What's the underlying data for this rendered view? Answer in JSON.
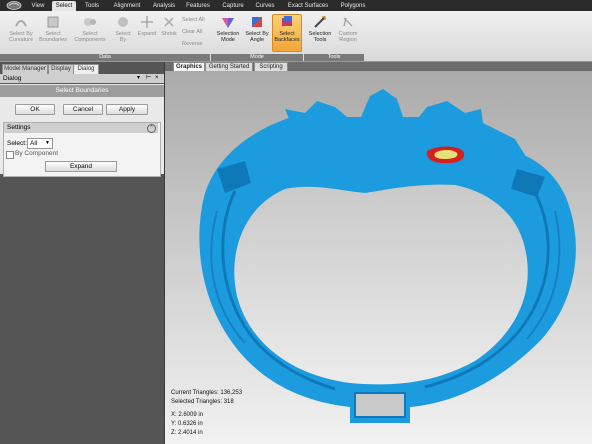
{
  "ribbon_tabs": [
    "View",
    "Select",
    "Tools",
    "Alignment",
    "Analysis",
    "Features",
    "Capture",
    "Curves",
    "Exact Surfaces",
    "Polygons"
  ],
  "ribbon": {
    "data_buttons": [
      "Select By Curvature",
      "Select Boundaries",
      "Select Components",
      "Select By",
      "Expand",
      "Shrink"
    ],
    "small_buttons": [
      "Select All",
      "Clear All",
      "Reverse"
    ],
    "mode_buttons": [
      "Selection Mode",
      "Select By Angle",
      "Select Backfaces"
    ],
    "tools_buttons": [
      "Selection Tools",
      "Custom Region"
    ],
    "groups": {
      "data": "Data",
      "mode": "Mode",
      "tools": "Tools"
    }
  },
  "panel": {
    "tabs": [
      "Model Manager",
      "Display",
      "Dialog"
    ],
    "header": "Dialog",
    "dialog_title": "Select Boundaries",
    "buttons": {
      "ok": "OK",
      "cancel": "Cancel",
      "apply": "Apply"
    },
    "settings": {
      "title": "Settings",
      "select_label": "Select:",
      "select_value": "All",
      "by_component": "By Component",
      "expand": "Expand"
    }
  },
  "viewport": {
    "tabs": [
      "Graphics",
      "Getting Started",
      "Scripting"
    ],
    "current_triangles": "Current Triangles: 136,253",
    "selected_triangles": "Selected Triangles: 318",
    "x": "X: 2.6009 in",
    "y": "Y: 0.6326 in",
    "z": "Z: 2.4014 in"
  },
  "colors": {
    "mesh": "#1c9cdf",
    "selection": "#d81f1f",
    "highlight": "#f2a637"
  }
}
